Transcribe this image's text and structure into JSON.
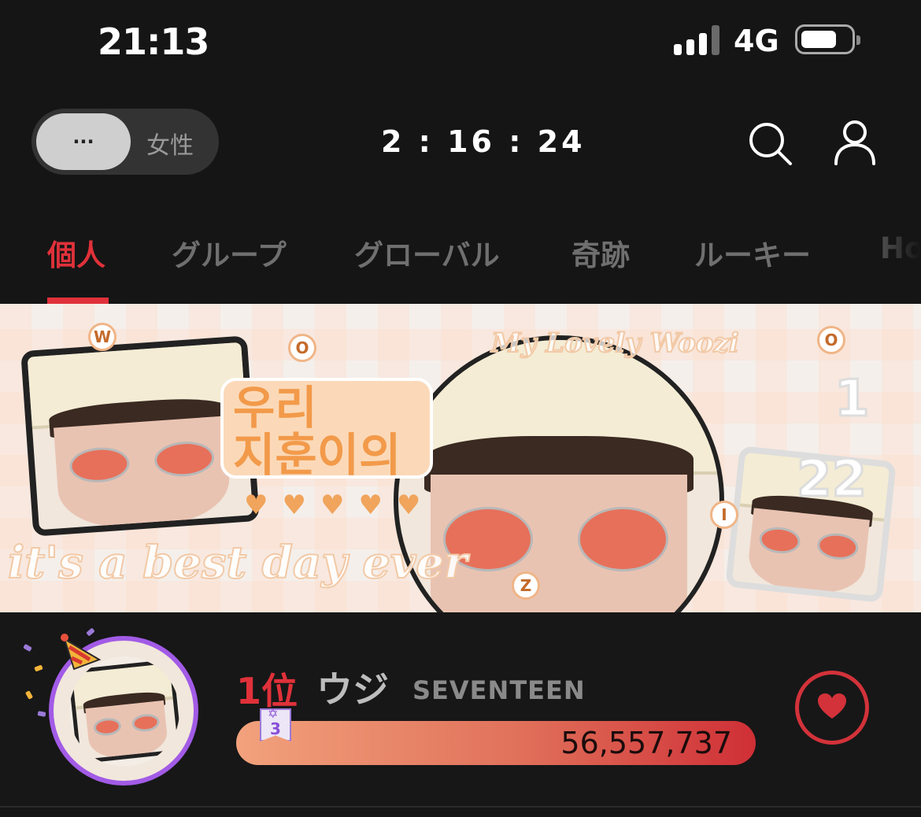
{
  "status_bar": {
    "time": "21:13",
    "network": "4G",
    "signal_bars": 3,
    "battery_level": 0.6
  },
  "header": {
    "toggle_left_label": "···",
    "toggle_right_label": "女性",
    "countdown": "2 : 16 : 24"
  },
  "tabs": [
    {
      "label": "個人",
      "active": true
    },
    {
      "label": "グループ",
      "active": false
    },
    {
      "label": "グローバル",
      "active": false
    },
    {
      "label": "奇跡",
      "active": false
    },
    {
      "label": "ルーキー",
      "active": false
    },
    {
      "label": "Ho",
      "active": false
    }
  ],
  "banner": {
    "title_line1": "우리",
    "title_line2": "지훈이의",
    "script_bottom": "it's a best day ever",
    "script_top": "My Lovely Woozi",
    "date_1": "1",
    "date_2": "22",
    "circle_letters": [
      "W",
      "O",
      "O",
      "Z",
      "I"
    ]
  },
  "ranking": {
    "position": "1位",
    "artist": "ウジ",
    "group": "SEVENTEEN",
    "votes": "56,557,737",
    "level": "3"
  },
  "colors": {
    "accent": "#e0313a",
    "avatar_ring": "#a25be6",
    "bar_start": "#f2a27c",
    "bar_end": "#cf2f36"
  },
  "icons": [
    "search-icon",
    "user-icon",
    "heart-icon",
    "party-hat-icon",
    "star-icon"
  ]
}
